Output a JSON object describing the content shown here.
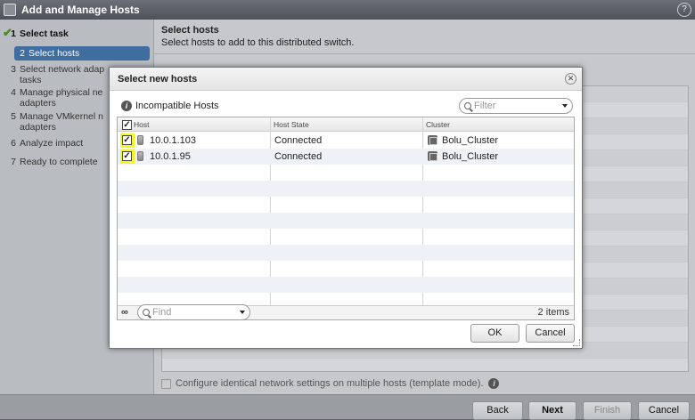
{
  "window": {
    "title": "Add and Manage Hosts",
    "help_label": "?"
  },
  "steps": [
    {
      "num": "1",
      "label": "Select task",
      "state": "done"
    },
    {
      "num": "2",
      "label": "Select hosts",
      "state": "active"
    },
    {
      "num": "3",
      "label": "Select network adap",
      "label2": "tasks",
      "state": "pending"
    },
    {
      "num": "4",
      "label": "Manage physical ne",
      "label2": "adapters",
      "state": "pending"
    },
    {
      "num": "5",
      "label": "Manage VMkernel n",
      "label2": "adapters",
      "state": "pending"
    },
    {
      "num": "6",
      "label": "Analyze impact",
      "state": "pending"
    },
    {
      "num": "7",
      "label": "Ready to complete",
      "state": "pending"
    }
  ],
  "main": {
    "title": "Select hosts",
    "subtitle": "Select hosts to add to this distributed switch.",
    "template_label": "Configure identical network settings on multiple hosts (template mode)."
  },
  "footer": {
    "back": "Back",
    "next": "Next",
    "finish": "Finish",
    "cancel": "Cancel"
  },
  "dialog": {
    "title": "Select new hosts",
    "incompatible_label": "Incompatible Hosts",
    "filter_placeholder": "Filter",
    "columns": [
      "Host",
      "Host State",
      "Cluster"
    ],
    "rows": [
      {
        "host": "10.0.1.103",
        "state": "Connected",
        "cluster": "Bolu_Cluster",
        "checked": true
      },
      {
        "host": "10.0.1.95",
        "state": "Connected",
        "cluster": "Bolu_Cluster",
        "checked": true
      }
    ],
    "find_placeholder": "Find",
    "items_count": "2 items",
    "ok": "OK",
    "cancel": "Cancel"
  },
  "colors": {
    "highlight": "#f3f52a",
    "active_step": "#3f6da0"
  }
}
